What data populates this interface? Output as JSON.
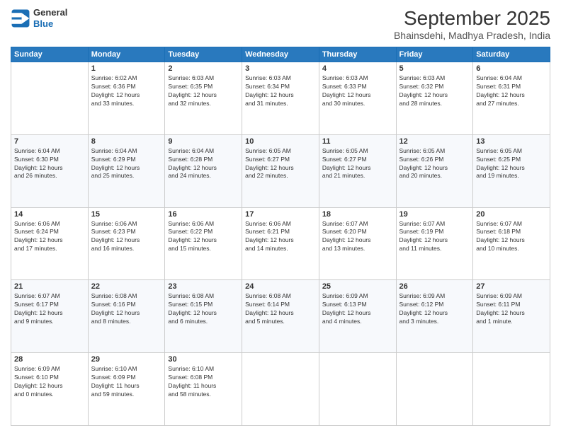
{
  "logo": {
    "line1": "General",
    "line2": "Blue"
  },
  "header": {
    "title": "September 2025",
    "subtitle": "Bhainsdehi, Madhya Pradesh, India"
  },
  "days_of_week": [
    "Sunday",
    "Monday",
    "Tuesday",
    "Wednesday",
    "Thursday",
    "Friday",
    "Saturday"
  ],
  "weeks": [
    [
      {
        "day": "",
        "info": ""
      },
      {
        "day": "1",
        "info": "Sunrise: 6:02 AM\nSunset: 6:36 PM\nDaylight: 12 hours\nand 33 minutes."
      },
      {
        "day": "2",
        "info": "Sunrise: 6:03 AM\nSunset: 6:35 PM\nDaylight: 12 hours\nand 32 minutes."
      },
      {
        "day": "3",
        "info": "Sunrise: 6:03 AM\nSunset: 6:34 PM\nDaylight: 12 hours\nand 31 minutes."
      },
      {
        "day": "4",
        "info": "Sunrise: 6:03 AM\nSunset: 6:33 PM\nDaylight: 12 hours\nand 30 minutes."
      },
      {
        "day": "5",
        "info": "Sunrise: 6:03 AM\nSunset: 6:32 PM\nDaylight: 12 hours\nand 28 minutes."
      },
      {
        "day": "6",
        "info": "Sunrise: 6:04 AM\nSunset: 6:31 PM\nDaylight: 12 hours\nand 27 minutes."
      }
    ],
    [
      {
        "day": "7",
        "info": "Sunrise: 6:04 AM\nSunset: 6:30 PM\nDaylight: 12 hours\nand 26 minutes."
      },
      {
        "day": "8",
        "info": "Sunrise: 6:04 AM\nSunset: 6:29 PM\nDaylight: 12 hours\nand 25 minutes."
      },
      {
        "day": "9",
        "info": "Sunrise: 6:04 AM\nSunset: 6:28 PM\nDaylight: 12 hours\nand 24 minutes."
      },
      {
        "day": "10",
        "info": "Sunrise: 6:05 AM\nSunset: 6:27 PM\nDaylight: 12 hours\nand 22 minutes."
      },
      {
        "day": "11",
        "info": "Sunrise: 6:05 AM\nSunset: 6:27 PM\nDaylight: 12 hours\nand 21 minutes."
      },
      {
        "day": "12",
        "info": "Sunrise: 6:05 AM\nSunset: 6:26 PM\nDaylight: 12 hours\nand 20 minutes."
      },
      {
        "day": "13",
        "info": "Sunrise: 6:05 AM\nSunset: 6:25 PM\nDaylight: 12 hours\nand 19 minutes."
      }
    ],
    [
      {
        "day": "14",
        "info": "Sunrise: 6:06 AM\nSunset: 6:24 PM\nDaylight: 12 hours\nand 17 minutes."
      },
      {
        "day": "15",
        "info": "Sunrise: 6:06 AM\nSunset: 6:23 PM\nDaylight: 12 hours\nand 16 minutes."
      },
      {
        "day": "16",
        "info": "Sunrise: 6:06 AM\nSunset: 6:22 PM\nDaylight: 12 hours\nand 15 minutes."
      },
      {
        "day": "17",
        "info": "Sunrise: 6:06 AM\nSunset: 6:21 PM\nDaylight: 12 hours\nand 14 minutes."
      },
      {
        "day": "18",
        "info": "Sunrise: 6:07 AM\nSunset: 6:20 PM\nDaylight: 12 hours\nand 13 minutes."
      },
      {
        "day": "19",
        "info": "Sunrise: 6:07 AM\nSunset: 6:19 PM\nDaylight: 12 hours\nand 11 minutes."
      },
      {
        "day": "20",
        "info": "Sunrise: 6:07 AM\nSunset: 6:18 PM\nDaylight: 12 hours\nand 10 minutes."
      }
    ],
    [
      {
        "day": "21",
        "info": "Sunrise: 6:07 AM\nSunset: 6:17 PM\nDaylight: 12 hours\nand 9 minutes."
      },
      {
        "day": "22",
        "info": "Sunrise: 6:08 AM\nSunset: 6:16 PM\nDaylight: 12 hours\nand 8 minutes."
      },
      {
        "day": "23",
        "info": "Sunrise: 6:08 AM\nSunset: 6:15 PM\nDaylight: 12 hours\nand 6 minutes."
      },
      {
        "day": "24",
        "info": "Sunrise: 6:08 AM\nSunset: 6:14 PM\nDaylight: 12 hours\nand 5 minutes."
      },
      {
        "day": "25",
        "info": "Sunrise: 6:09 AM\nSunset: 6:13 PM\nDaylight: 12 hours\nand 4 minutes."
      },
      {
        "day": "26",
        "info": "Sunrise: 6:09 AM\nSunset: 6:12 PM\nDaylight: 12 hours\nand 3 minutes."
      },
      {
        "day": "27",
        "info": "Sunrise: 6:09 AM\nSunset: 6:11 PM\nDaylight: 12 hours\nand 1 minute."
      }
    ],
    [
      {
        "day": "28",
        "info": "Sunrise: 6:09 AM\nSunset: 6:10 PM\nDaylight: 12 hours\nand 0 minutes."
      },
      {
        "day": "29",
        "info": "Sunrise: 6:10 AM\nSunset: 6:09 PM\nDaylight: 11 hours\nand 59 minutes."
      },
      {
        "day": "30",
        "info": "Sunrise: 6:10 AM\nSunset: 6:08 PM\nDaylight: 11 hours\nand 58 minutes."
      },
      {
        "day": "",
        "info": ""
      },
      {
        "day": "",
        "info": ""
      },
      {
        "day": "",
        "info": ""
      },
      {
        "day": "",
        "info": ""
      }
    ]
  ]
}
